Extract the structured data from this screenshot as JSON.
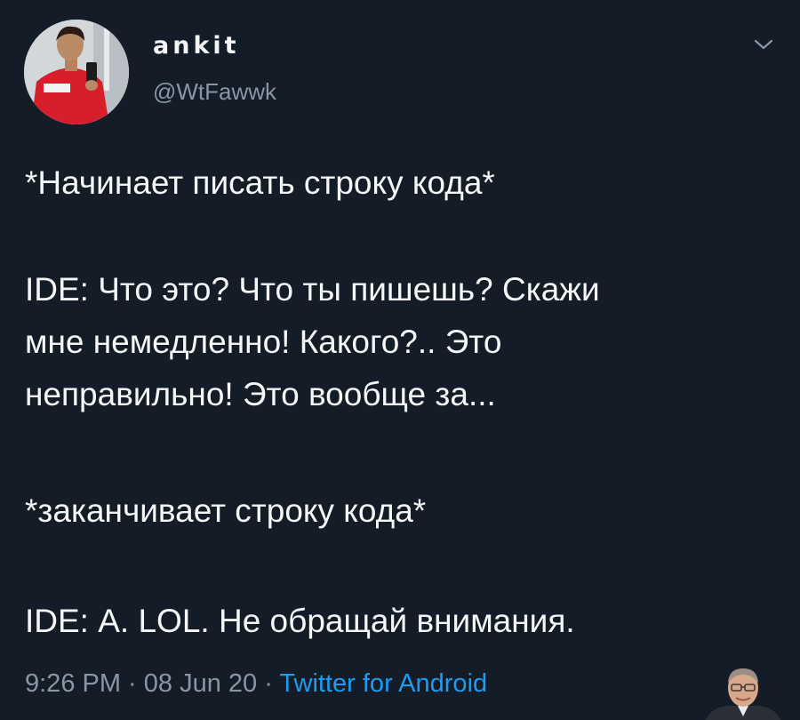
{
  "tweet": {
    "display_name": "ankit",
    "handle": "@WtFawwk",
    "paragraphs": [
      "*Начинает писать строку кода*",
      "IDE: Что это? Что ты пишешь? Скажи",
      "мне немедленно! Какого?.. Это",
      "неправильно! Это вообще за...",
      "*заканчивает строку кода*",
      "IDE: А. LOL. Не обращай внимания."
    ],
    "time": "9:26 PM",
    "separator": " · ",
    "date": "08 Jun 20",
    "source": "Twitter for Android"
  },
  "icons": {
    "avatar": "profile-photo",
    "menu": "chevron-down-icon",
    "sticker": "person-face-sticker"
  },
  "colors": {
    "background": "#141c27",
    "text": "#f4f6f8",
    "muted": "#8a96a3",
    "link": "#1d9bf0"
  }
}
